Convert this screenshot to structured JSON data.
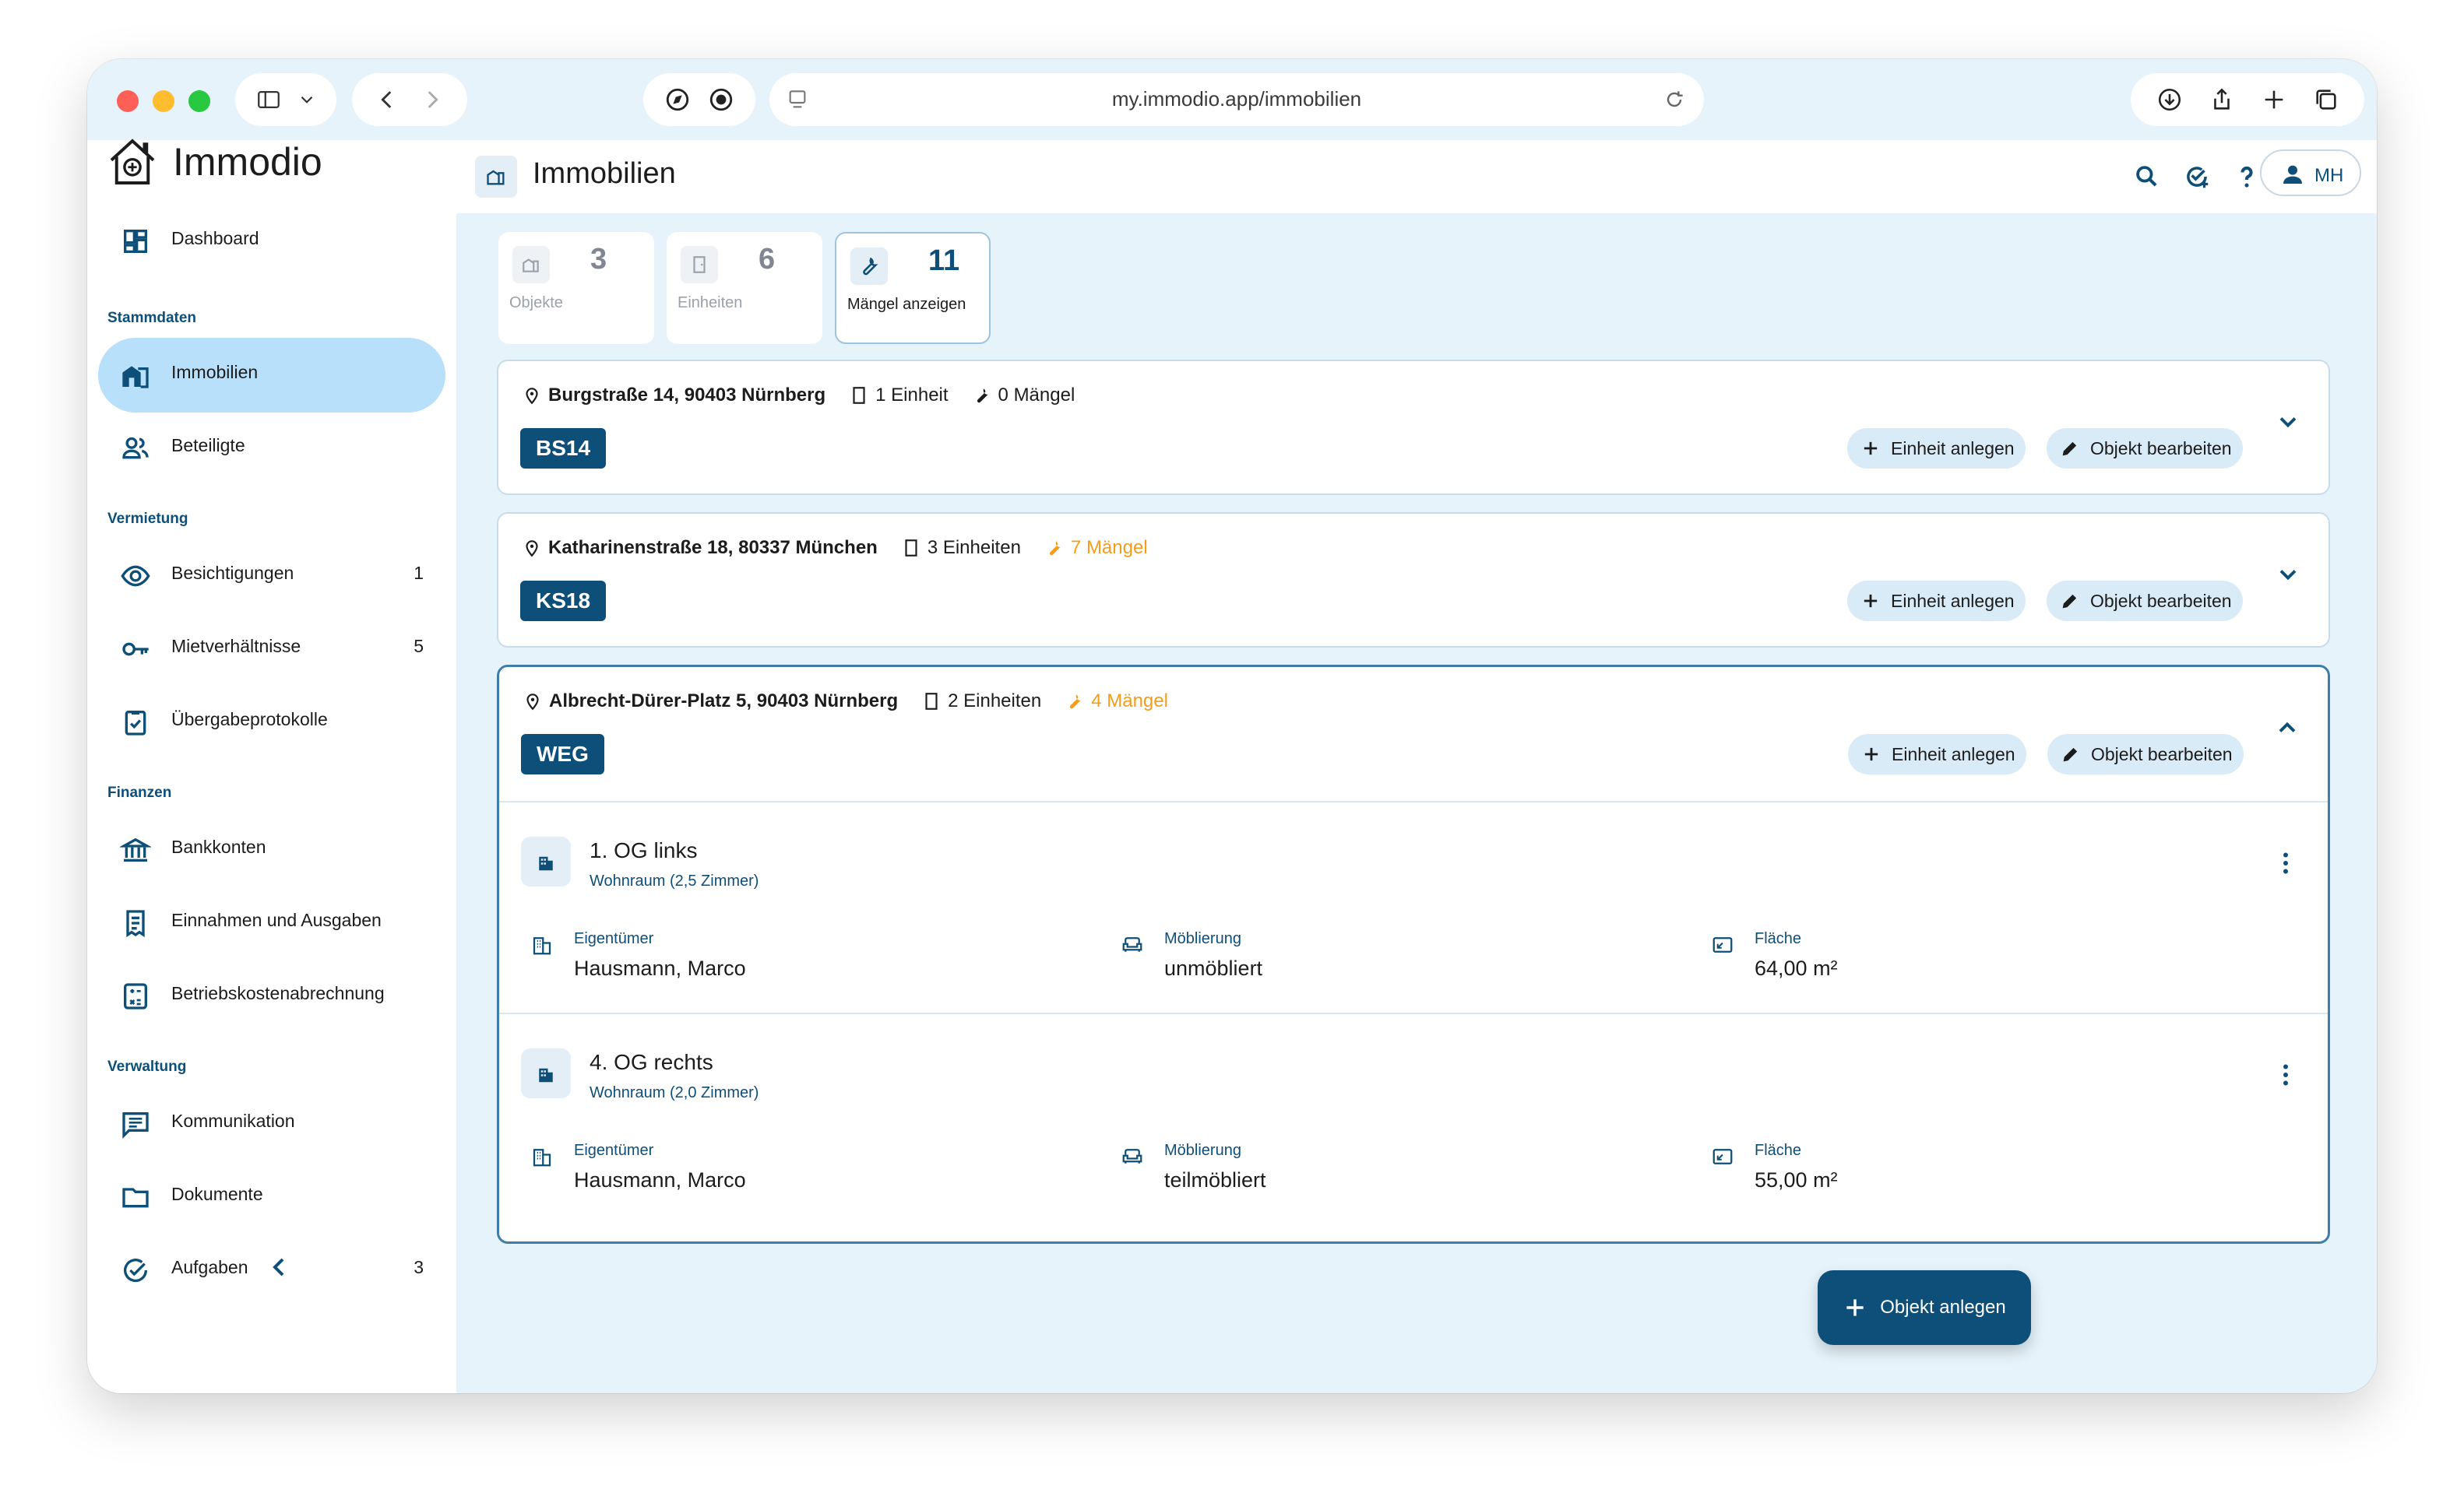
{
  "browser": {
    "url": "my.immodio.app/immobilien"
  },
  "app": {
    "name": "Immodio"
  },
  "sidebar": {
    "dashboard": "Dashboard",
    "sections": {
      "stammdaten": "Stammdaten",
      "vermietung": "Vermietung",
      "finanzen": "Finanzen",
      "verwaltung": "Verwaltung"
    },
    "items": {
      "immobilien": "Immobilien",
      "beteiligte": "Beteiligte",
      "besichtigungen": "Besichtigungen",
      "besichtigungen_count": "1",
      "mietverhaeltnisse": "Mietverhältnisse",
      "mietverhaeltnisse_count": "5",
      "uebergabeprotokolle": "Übergabeprotokolle",
      "bankkonten": "Bankkonten",
      "einnahmen": "Einnahmen und Ausgaben",
      "betriebskosten": "Betriebskostenabrechnung",
      "kommunikation": "Kommunikation",
      "dokumente": "Dokumente",
      "aufgaben": "Aufgaben",
      "aufgaben_count": "3"
    }
  },
  "header": {
    "title": "Immobilien",
    "user_initials": "MH"
  },
  "stats": {
    "objekte": {
      "value": "3",
      "label": "Objekte"
    },
    "einheiten": {
      "value": "6",
      "label": "Einheiten"
    },
    "maengel": {
      "value": "11",
      "label": "Mängel anzeigen"
    }
  },
  "properties": [
    {
      "address": "Burgstraße 14, 90403 Nürnberg",
      "units": "1 Einheit",
      "defects": "0 Mängel",
      "tag": "BS14",
      "add_unit": "Einheit anlegen",
      "edit": "Objekt bearbeiten"
    },
    {
      "address": "Katharinenstraße 18, 80337 München",
      "units": "3 Einheiten",
      "defects": "7 Mängel",
      "tag": "KS18",
      "add_unit": "Einheit anlegen",
      "edit": "Objekt bearbeiten"
    },
    {
      "address": "Albrecht-Dürer-Platz 5, 90403 Nürnberg",
      "units": "2 Einheiten",
      "defects": "4 Mängel",
      "tag": "WEG",
      "add_unit": "Einheit anlegen",
      "edit": "Objekt bearbeiten",
      "unit_list": [
        {
          "name": "1. OG links",
          "subtitle": "Wohnraum (2,5 Zimmer)",
          "owner_label": "Eigentümer",
          "owner": "Hausmann, Marco",
          "furnish_label": "Möblierung",
          "furnish": "unmöbliert",
          "area_label": "Fläche",
          "area": "64,00 m²"
        },
        {
          "name": "4. OG rechts",
          "subtitle": "Wohnraum (2,0 Zimmer)",
          "owner_label": "Eigentümer",
          "owner": "Hausmann, Marco",
          "furnish_label": "Möblierung",
          "furnish": "teilmöbliert",
          "area_label": "Fläche",
          "area": "55,00 m²"
        }
      ]
    }
  ],
  "fab": {
    "label": "Objekt anlegen"
  },
  "colors": {
    "primary": "#0d4f78",
    "active_nav": "#b8e0fb",
    "background": "#e6f3fb",
    "warning": "#f59c1a"
  }
}
